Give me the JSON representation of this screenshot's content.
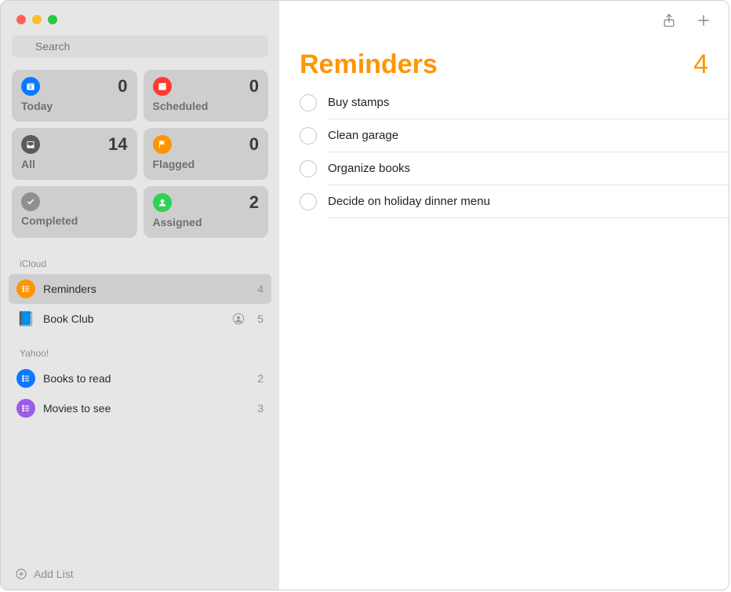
{
  "sidebar": {
    "search": {
      "placeholder": "Search"
    },
    "smart": [
      {
        "label": "Today",
        "count": "0",
        "icon": "calendar-today-icon",
        "color": "ic-blue"
      },
      {
        "label": "Scheduled",
        "count": "0",
        "icon": "calendar-icon",
        "color": "ic-red"
      },
      {
        "label": "All",
        "count": "14",
        "icon": "tray-icon",
        "color": "ic-dark"
      },
      {
        "label": "Flagged",
        "count": "0",
        "icon": "flag-icon",
        "color": "ic-orange"
      },
      {
        "label": "Completed",
        "count": "",
        "icon": "check-icon",
        "color": "ic-gray"
      },
      {
        "label": "Assigned",
        "count": "2",
        "icon": "person-icon",
        "color": "ic-green"
      }
    ],
    "sections": [
      {
        "title": "iCloud",
        "lists": [
          {
            "name": "Reminders",
            "count": "4",
            "color": "#ff9500",
            "shared": false,
            "selected": true,
            "glyph": "list"
          },
          {
            "name": "Book Club",
            "count": "5",
            "color": "#1169d4",
            "shared": true,
            "selected": false,
            "glyph": "book"
          }
        ]
      },
      {
        "title": "Yahoo!",
        "lists": [
          {
            "name": "Books to read",
            "count": "2",
            "color": "#0a7aff",
            "shared": false,
            "selected": false,
            "glyph": "list"
          },
          {
            "name": "Movies to see",
            "count": "3",
            "color": "#9a5be8",
            "shared": false,
            "selected": false,
            "glyph": "list"
          }
        ]
      }
    ],
    "add_list_label": "Add List"
  },
  "main": {
    "title": "Reminders",
    "count": "4",
    "items": [
      {
        "title": "Buy stamps"
      },
      {
        "title": "Clean garage"
      },
      {
        "title": "Organize books"
      },
      {
        "title": "Decide on holiday dinner menu"
      }
    ]
  }
}
